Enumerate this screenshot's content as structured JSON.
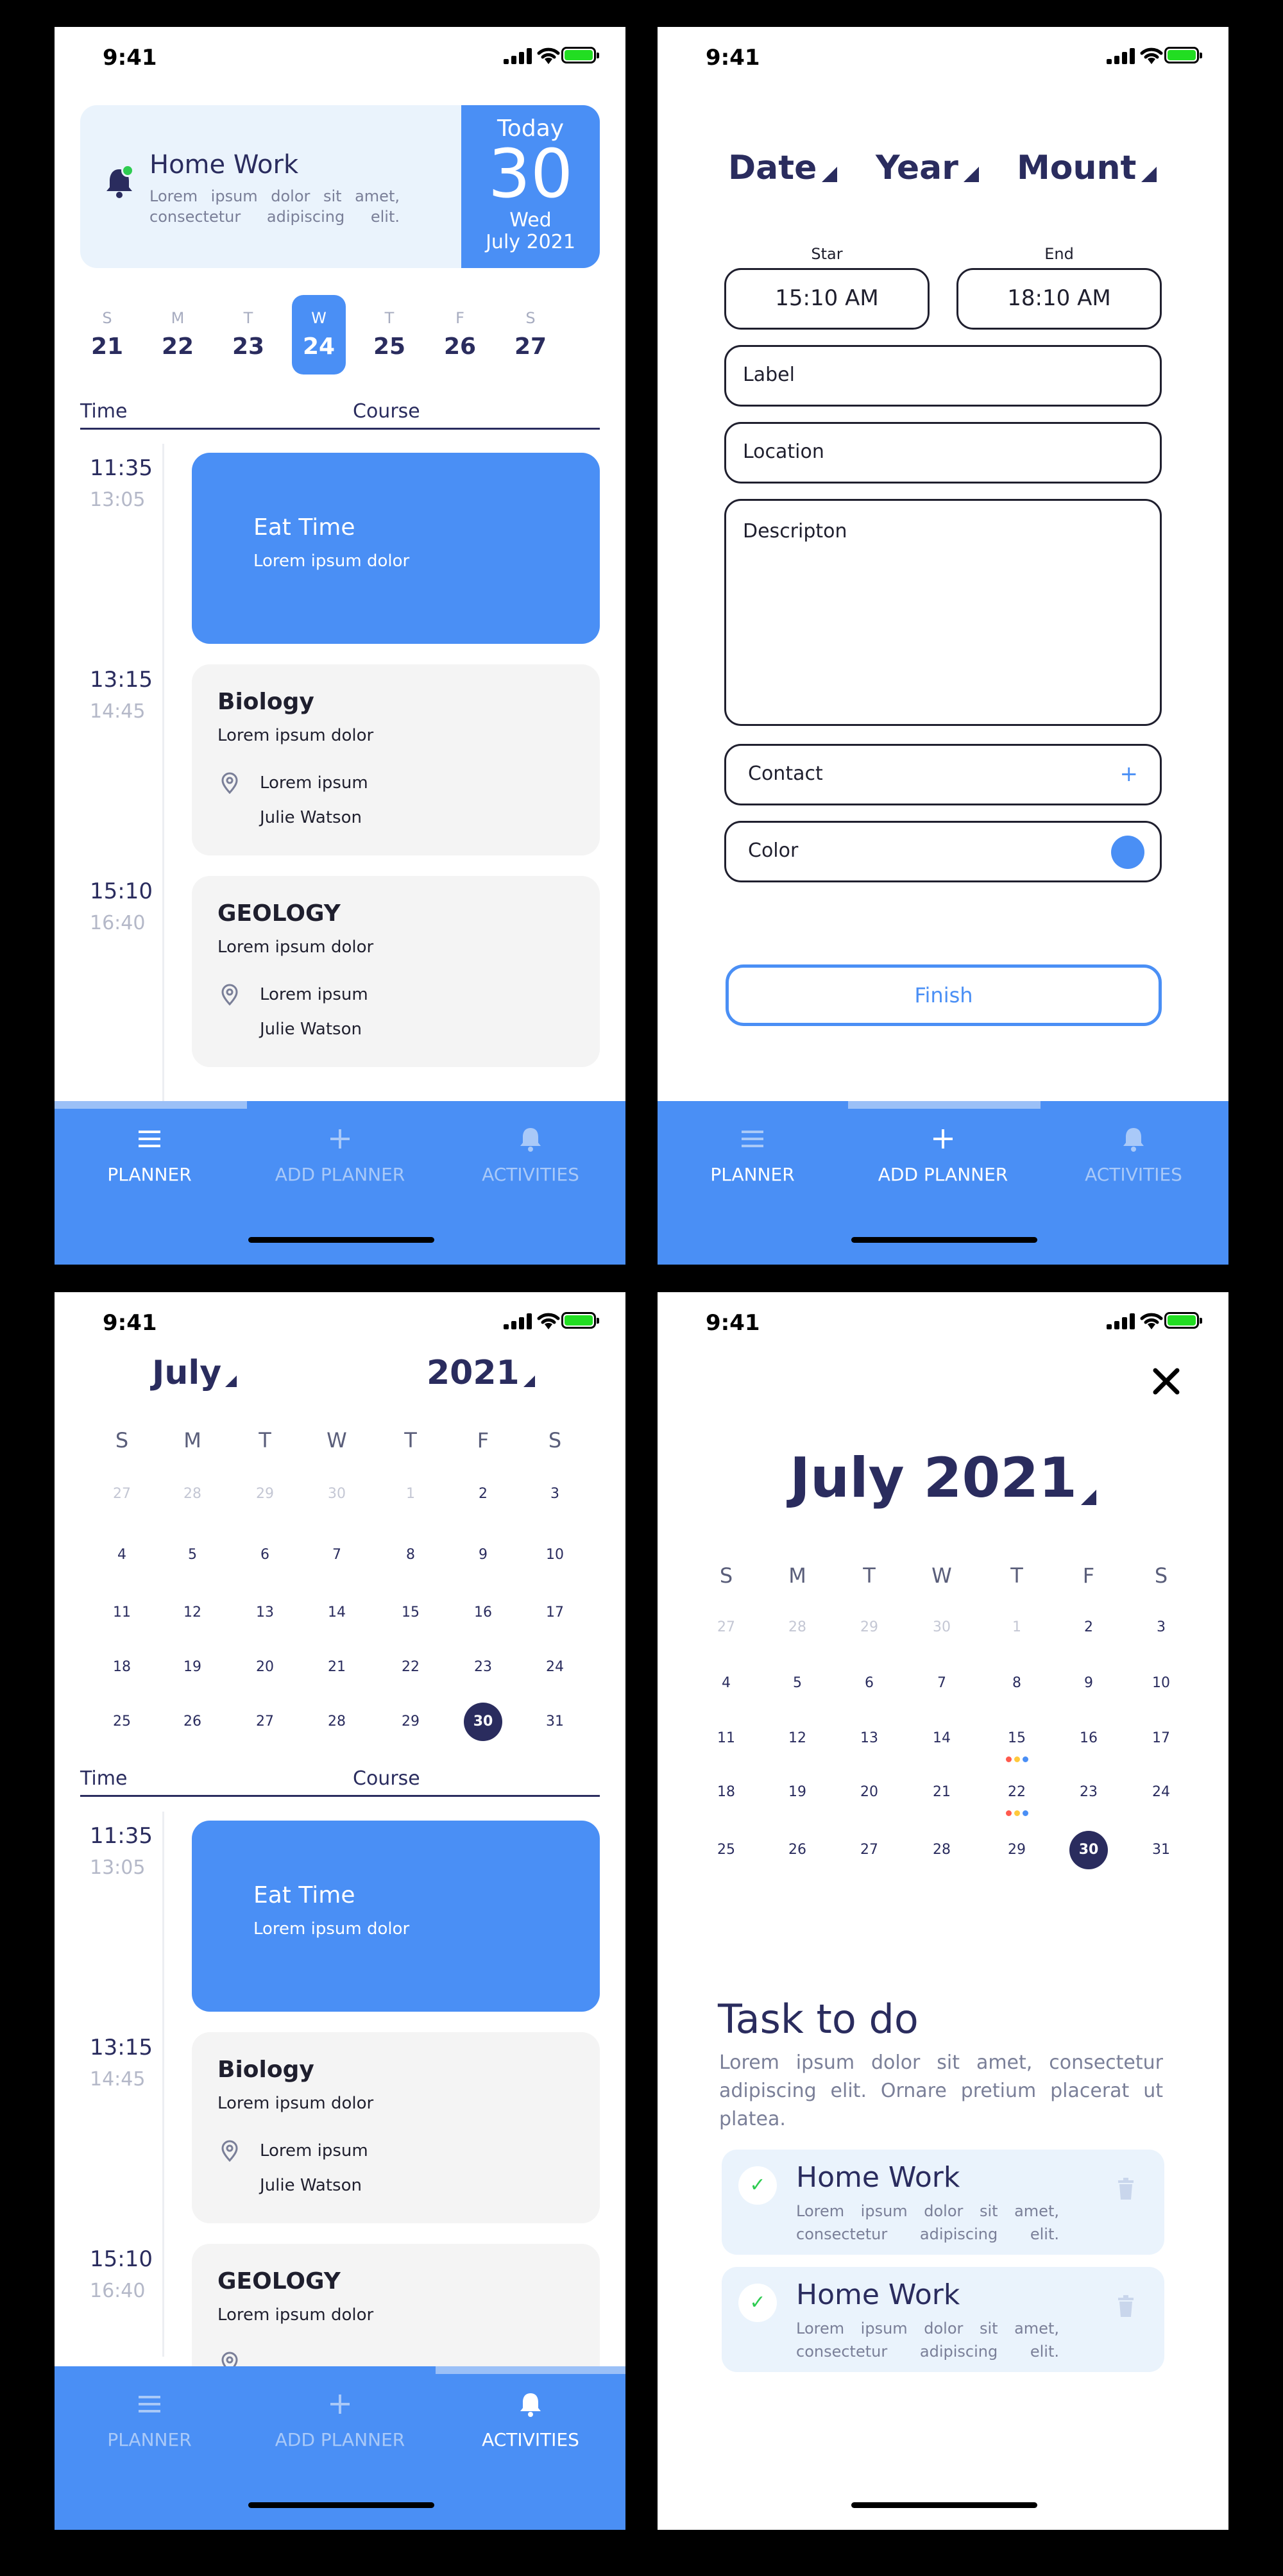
{
  "status": {
    "time": "9:41"
  },
  "nav": {
    "planner": "PLANNER",
    "add_planner": "ADD PLANNER",
    "activities": "ACTIVITIES"
  },
  "screen1": {
    "header": {
      "title": "Home Work",
      "desc": "Lorem ipsum dolor sit amet, consectetur adipiscing elit.",
      "today_label": "Today",
      "day": "30",
      "weekday": "Wed",
      "month_year": "July 2021"
    },
    "week": [
      {
        "l": "S",
        "n": "21"
      },
      {
        "l": "M",
        "n": "22"
      },
      {
        "l": "T",
        "n": "23"
      },
      {
        "l": "W",
        "n": "24"
      },
      {
        "l": "T",
        "n": "25"
      },
      {
        "l": "F",
        "n": "26"
      },
      {
        "l": "S",
        "n": "27"
      }
    ],
    "schedule_header": {
      "time": "Time",
      "course": "Course"
    },
    "events": [
      {
        "start": "11:35",
        "end": "13:05",
        "title": "Eat Time",
        "desc": "Lorem ipsum dolor"
      },
      {
        "start": "13:15",
        "end": "14:45",
        "title": "Biology",
        "desc": "Lorem ipsum dolor",
        "location": "Lorem ipsum",
        "person": "Julie Watson"
      },
      {
        "start": "15:10",
        "end": "16:40",
        "title": "GEOLOGY",
        "desc": "Lorem ipsum dolor",
        "location": "Lorem ipsum",
        "person": "Julie Watson"
      }
    ]
  },
  "screen2": {
    "dropdowns": {
      "date": "Date",
      "year": "Year",
      "month": "Mount"
    },
    "start_label": "Star",
    "end_label": "End",
    "start_time": "15:10 AM",
    "end_time": "18:10 AM",
    "fields": {
      "label": "Label",
      "location": "Location",
      "description": "Descripton",
      "contact": "Contact",
      "contact_icon": "+",
      "color": "Color"
    },
    "accent_color": "#4a8ff5",
    "finish": "Finish"
  },
  "screen3": {
    "month": "July",
    "year": "2021",
    "headers": [
      "S",
      "M",
      "T",
      "W",
      "T",
      "F",
      "S"
    ],
    "days": [
      [
        "27",
        "28",
        "29",
        "30",
        "1",
        "2",
        "3"
      ],
      [
        "4",
        "5",
        "6",
        "7",
        "8",
        "9",
        "10"
      ],
      [
        "11",
        "12",
        "13",
        "14",
        "15",
        "16",
        "17"
      ],
      [
        "18",
        "19",
        "20",
        "21",
        "22",
        "23",
        "24"
      ],
      [
        "25",
        "26",
        "27",
        "28",
        "29",
        "30",
        "31"
      ]
    ],
    "muted_first_row": 5,
    "selected": "30"
  },
  "screen4": {
    "month_year": "July 2021",
    "task_title": "Task to do",
    "task_desc": "Lorem ipsum dolor sit amet, consectetur adipiscing elit. Ornare pretium placerat ut platea.",
    "tasks": [
      {
        "title": "Home Work",
        "desc": "Lorem ipsum dolor sit amet, consectetur adipiscing elit."
      },
      {
        "title": "Home Work",
        "desc": "Lorem ipsum dolor sit amet, consectetur adipiscing elit."
      }
    ],
    "dot_colors": [
      "#ff5a4e",
      "#ffc93c",
      "#4a8ff5"
    ],
    "check_icon": "✓"
  },
  "colors": {
    "primary": "#4a8ff5",
    "dark": "#2a2c5e",
    "card_grey": "#f4f4f4",
    "light_blue": "#eaf3fc"
  }
}
